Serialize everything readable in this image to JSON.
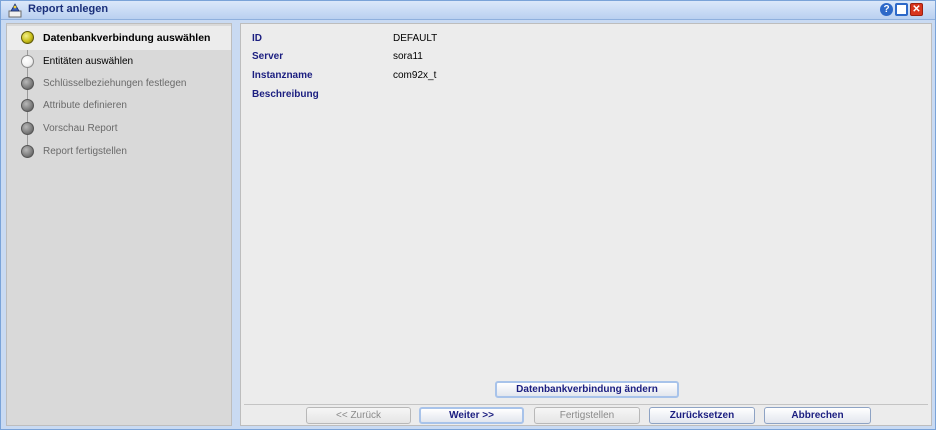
{
  "window": {
    "title": "Report anlegen",
    "help_glyph": "?",
    "close_glyph": "✕"
  },
  "steps": [
    {
      "label": "Datenbankverbindung auswählen",
      "state": "active"
    },
    {
      "label": "Entitäten auswählen",
      "state": "next"
    },
    {
      "label": "Schlüsselbeziehungen festlegen",
      "state": "disabled"
    },
    {
      "label": "Attribute definieren",
      "state": "disabled"
    },
    {
      "label": "Vorschau Report",
      "state": "disabled"
    },
    {
      "label": "Report fertigstellen",
      "state": "disabled"
    }
  ],
  "details": [
    {
      "label": "ID",
      "value": "DEFAULT"
    },
    {
      "label": "Server",
      "value": "sora11"
    },
    {
      "label": "Instanzname",
      "value": "com92x_t"
    },
    {
      "label": "Beschreibung",
      "value": ""
    }
  ],
  "buttons": {
    "change_connection": "Datenbankverbindung ändern",
    "back": "<< Zurück",
    "next": "Weiter >>",
    "finish": "Fertigstellen",
    "reset": "Zurücksetzen",
    "cancel": "Abbrechen"
  },
  "colors": {
    "title_text": "#1a2f7a",
    "label_text": "#1b1e80",
    "active_step_dot": "#c9bf1a"
  }
}
